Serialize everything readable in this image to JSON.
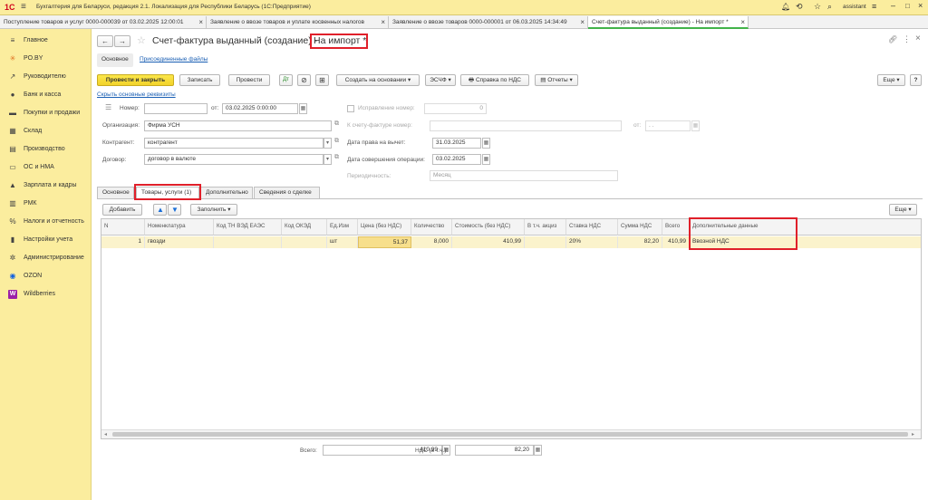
{
  "app": {
    "logo": "1С",
    "title": "Бухгалтерия для Беларуси, редакция 2.1. Локализация для Республики Беларусь   (1С:Предприятие)",
    "user": "assistant"
  },
  "tabs": [
    {
      "label": "Поступление товаров и услуг 0000-000039 от 03.02.2025 12:00:01"
    },
    {
      "label": "Заявление о ввозе товаров и уплате косвенных налогов"
    },
    {
      "label": "Заявление о ввозе товаров 0000-000001 от 06.03.2025 14:34:49"
    },
    {
      "label": "Счет-фактура выданный (создание) - На импорт *"
    }
  ],
  "sidebar": {
    "items": [
      {
        "label": "Главное",
        "icon": "≡"
      },
      {
        "label": "PO.BY",
        "icon": "✳"
      },
      {
        "label": "Руководителю",
        "icon": "↗"
      },
      {
        "label": "Банк и касса",
        "icon": "●"
      },
      {
        "label": "Покупки и продажи",
        "icon": "▬"
      },
      {
        "label": "Склад",
        "icon": "▦"
      },
      {
        "label": "Производство",
        "icon": "▤"
      },
      {
        "label": "ОС и НМА",
        "icon": "▭"
      },
      {
        "label": "Зарплата и кадры",
        "icon": "▲"
      },
      {
        "label": "РМК",
        "icon": "▥"
      },
      {
        "label": "Налоги и отчетность",
        "icon": "%"
      },
      {
        "label": "Настройки учета",
        "icon": "▮"
      },
      {
        "label": "Администрирование",
        "icon": "✲"
      },
      {
        "label": "OZON",
        "icon": "◉"
      },
      {
        "label": "Wildberries",
        "icon": "W"
      }
    ]
  },
  "doc": {
    "title": "Счет-фактура выданный (создание) -",
    "title_highlight": "На импорт *",
    "subtabs": [
      "Основное",
      "Присоединенные файлы"
    ]
  },
  "toolbar": {
    "post_close": "Провести и закрыть",
    "save": "Записать",
    "post": "Провести",
    "create_based": "Создать на основании",
    "esch": "ЭСЧФ",
    "vat_ref": "Справка по НДС",
    "reports": "Отчеты",
    "more": "Еще"
  },
  "form": {
    "hide_link": "Скрыть основные реквизиты",
    "number_label": "Номер:",
    "number_value": "",
    "from_label": "от:",
    "date_value": "03.02.2025  0:00:00",
    "correction_label": "Исправление номер:",
    "correction_value": "0",
    "org_label": "Организация:",
    "org_value": "Фирма УСН",
    "to_invoice_label": "К счету-фактуре номер:",
    "to_invoice_value": "",
    "from2_label": "от:",
    "from2_value": ". .",
    "contractor_label": "Контрагент:",
    "contractor_value": "контрагент",
    "deduction_label": "Дата права на вычет:",
    "deduction_value": "31.03.2025",
    "contract_label": "Договор:",
    "contract_value": "договор в валюте",
    "operation_label": "Дата совершения операции:",
    "operation_value": "03.02.2025",
    "period_label": "Периодичность:",
    "period_value": "Месяц"
  },
  "form_tabs": [
    "Основное",
    "Товары, услуги (1)",
    "Дополнительно",
    "Сведения о сделке"
  ],
  "grid_toolbar": {
    "add": "Добавить",
    "fill": "Заполнить",
    "more": "Еще"
  },
  "grid": {
    "columns": [
      "N",
      "Номенклатура",
      "Код ТН ВЭД ЕАЭС",
      "Код ОКЭД",
      "Ед.Изм",
      "Цена (без НДС)",
      "Количество",
      "Стоимость (без НДС)",
      "В т.ч. акциз",
      "Ставка НДС",
      "Сумма НДС",
      "Всего",
      "Дополнительные данные"
    ],
    "rows": [
      [
        "1",
        "гвозди",
        "",
        "",
        "шт",
        "51,37",
        "8,000",
        "410,99",
        "",
        "20%",
        "82,20",
        "410,99",
        "Ввозной НДС"
      ]
    ]
  },
  "totals": {
    "total_label": "Всего:",
    "total_value": "410,99",
    "vat_label": "НДС (в т.ч.):",
    "vat_value": "82,20"
  }
}
